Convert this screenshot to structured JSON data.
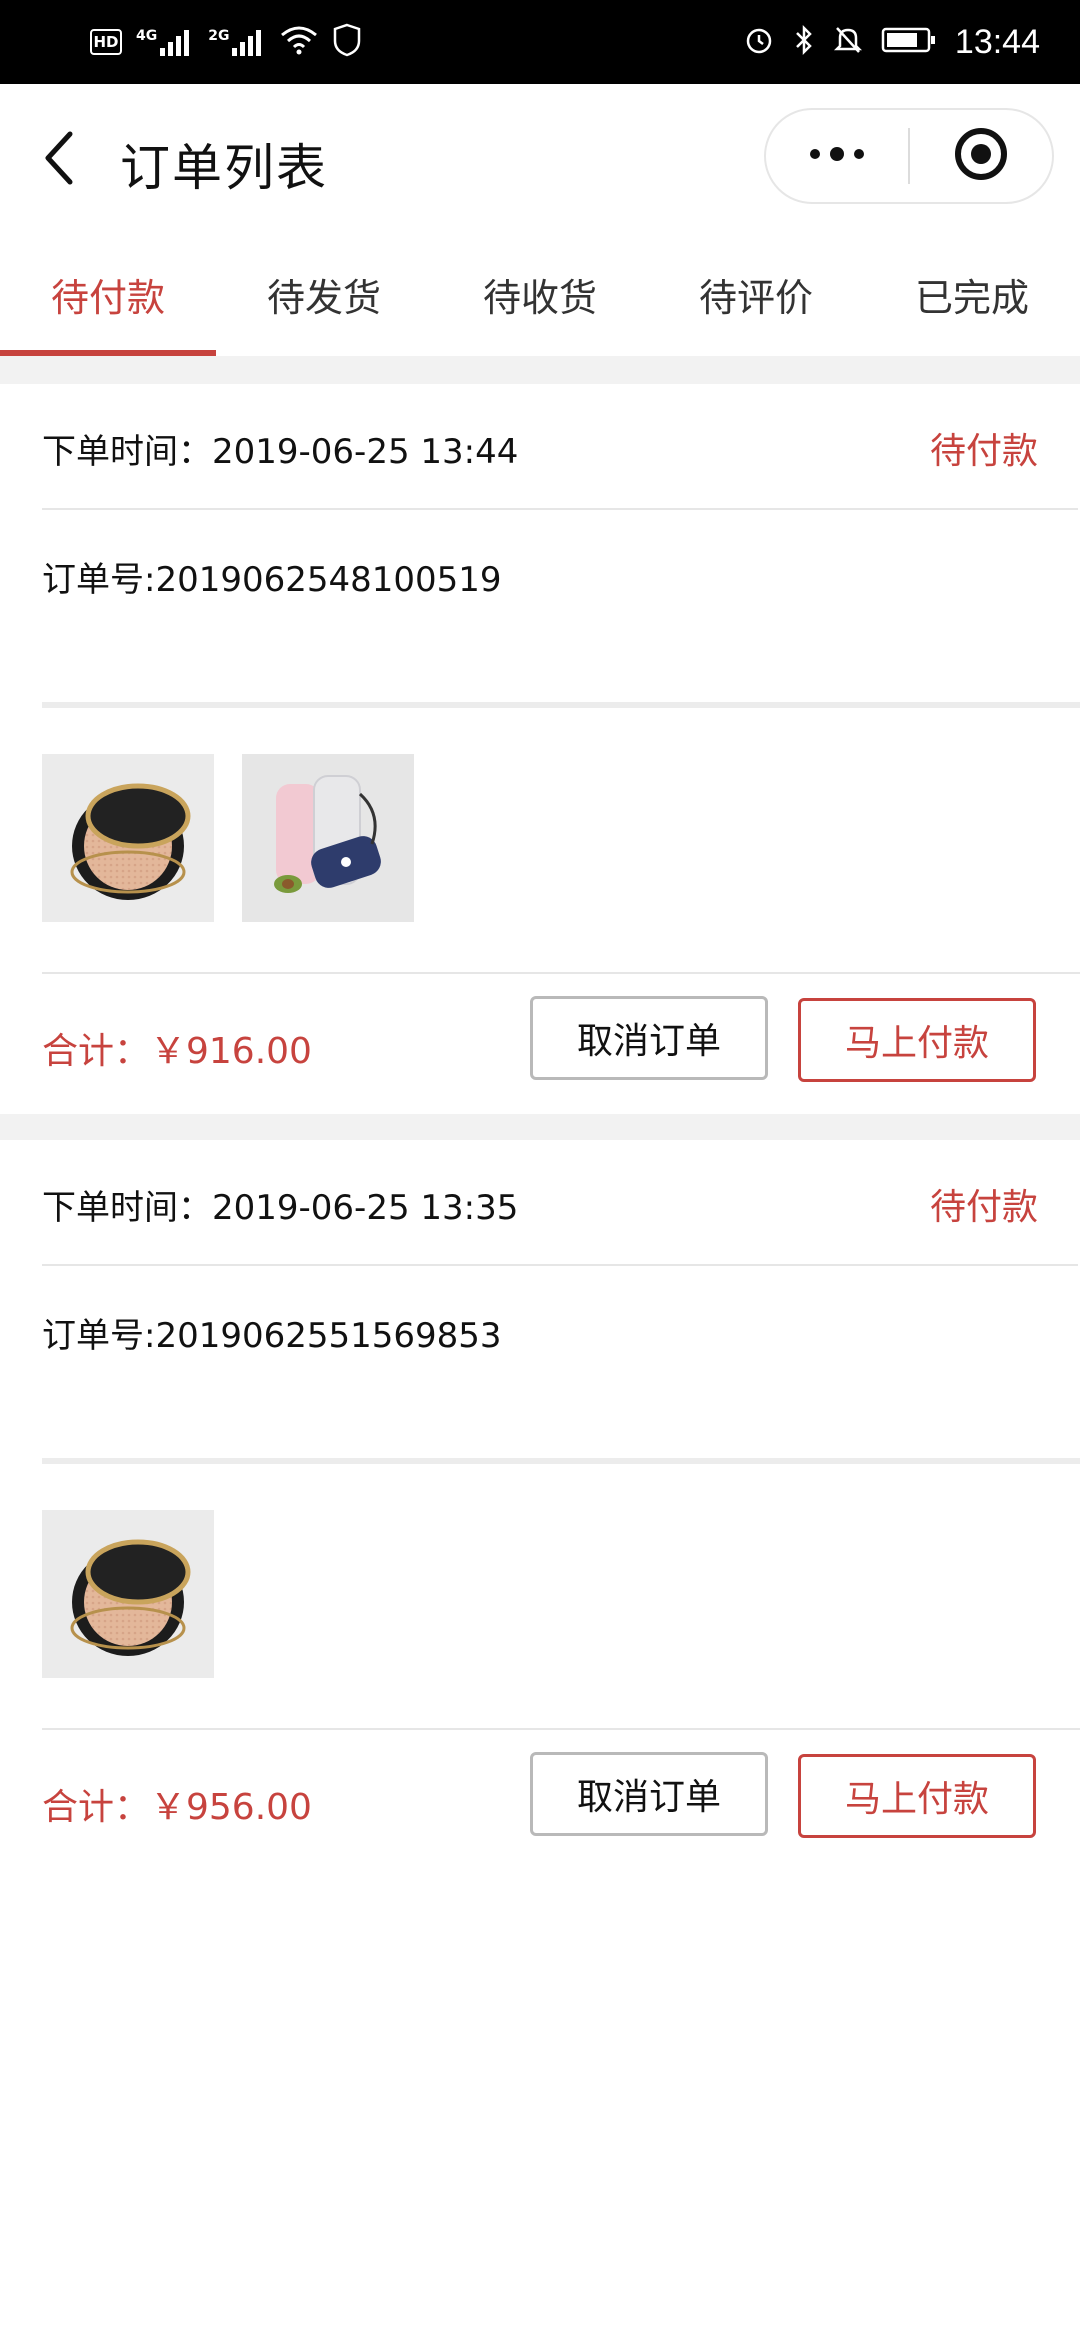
{
  "status_bar": {
    "network_badge": "HD",
    "signal1": "4G",
    "signal2": "2G",
    "time": "13:44",
    "icons": [
      "hd-icon",
      "signal-icon",
      "wifi-icon",
      "shield-icon",
      "alarm-icon",
      "bluetooth-icon",
      "mute-icon",
      "battery-icon"
    ]
  },
  "header": {
    "title": "订单列表",
    "back_icon": "chevron-left-icon",
    "more_icon": "more-dots-icon",
    "close_icon": "target-icon"
  },
  "tabs": [
    {
      "label": "待付款",
      "active": true
    },
    {
      "label": "待发货",
      "active": false
    },
    {
      "label": "待收货",
      "active": false
    },
    {
      "label": "待评价",
      "active": false
    },
    {
      "label": "已完成",
      "active": false
    }
  ],
  "orders": [
    {
      "time_label": "下单时间：2019-06-25 13:44",
      "status": "待付款",
      "order_no": "订单号:2019062548100519",
      "items": [
        "cushion-compact",
        "portable-blender"
      ],
      "total": "合计：￥916.00",
      "cancel_label": "取消订单",
      "pay_label": "马上付款"
    },
    {
      "time_label": "下单时间：2019-06-25 13:35",
      "status": "待付款",
      "order_no": "订单号:2019062551569853",
      "items": [
        "cushion-compact"
      ],
      "total": "合计：￥956.00",
      "cancel_label": "取消订单",
      "pay_label": "马上付款"
    }
  ],
  "colors": {
    "accent": "#c7433e",
    "divider": "#e6e6e6",
    "background_gap": "#f2f2f2"
  }
}
